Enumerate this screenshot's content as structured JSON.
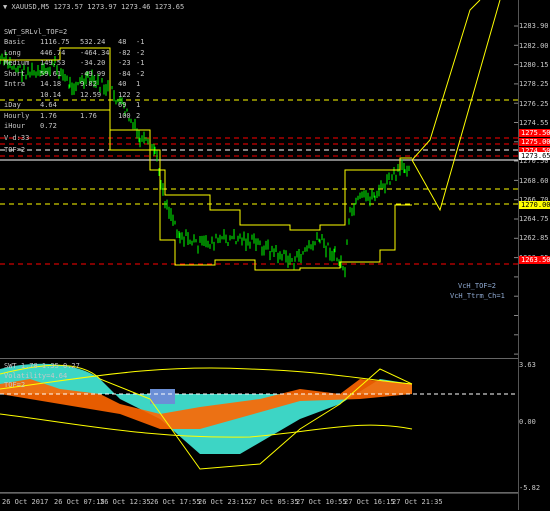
{
  "header": {
    "symbol_line": "XAUUSD,M5  1273.57 1273.97 1273.46 1273.65"
  },
  "info_block": {
    "title": "SWT_SRLvl_TOF=2",
    "rows": [
      {
        "label": "Basic",
        "c1": "1116.75",
        "c2": "532.24",
        "c3": "48",
        "c4": "-1"
      },
      {
        "label": "Long",
        "c1": "446.74",
        "c2": "-464.34",
        "c3": "-82",
        "c4": "-2"
      },
      {
        "label": "Medium",
        "c1": "149.53",
        "c2": "-34.20",
        "c3": "-23",
        "c4": "-1"
      },
      {
        "label": "Short",
        "c1": "59.61",
        "c2": "-49.99",
        "c3": "-84",
        "c4": "-2"
      },
      {
        "label": "Intra",
        "c1": "14.18",
        "c2": "9.82",
        "c3": "40",
        "c4": "1"
      },
      {
        "label": "",
        "c1": "10.14",
        "c2": "12.59",
        "c3": "122",
        "c4": "2"
      },
      {
        "label": "iDay",
        "c1": "4.64",
        "c2": "",
        "c3": "69",
        "c4": "1"
      },
      {
        "label": "Hourly",
        "c1": "1.76",
        "c2": "1.76",
        "c3": "100",
        "c4": "2"
      },
      {
        "label": "iHour",
        "c1": "0.72",
        "c2": "",
        "c3": "",
        "c4": ""
      }
    ],
    "vd_label": "V d:33",
    "tof_label": "TOF=2"
  },
  "price_axis": {
    "labels": [
      "1283.90",
      "1282.00",
      "1280.15",
      "1278.25",
      "1276.25",
      "1274.55",
      "1272.65",
      "1270.50",
      "1268.60",
      "1266.70",
      "1264.75",
      "1262.85",
      "1260.95"
    ],
    "tags": [
      {
        "text": "1275.50",
        "bg": "#ff0000",
        "fg": "#ffffff"
      },
      {
        "text": "1275.00",
        "bg": "#ff0000",
        "fg": "#ffffff"
      },
      {
        "text": "1274.50",
        "bg": "#ff0000",
        "fg": "#ffffff"
      },
      {
        "text": "1273.65",
        "bg": "#ffffff",
        "fg": "#000000"
      },
      {
        "text": "1270.00",
        "bg": "#ffff00",
        "fg": "#000000"
      },
      {
        "text": "1263.50",
        "bg": "#ff0000",
        "fg": "#ffffff"
      }
    ]
  },
  "main_labels": {
    "vch_tof": "VcH_TOF=2",
    "vch_ttrm": "VcH_Ttrm_Ch=1"
  },
  "sub_header": {
    "title": "SWT  1.78  1.35  0.27",
    "volatility": "Volatility=4.64",
    "tof": "TOF=2"
  },
  "sub_axis": {
    "top": "3.63",
    "mid": "0.00",
    "bottom": "-5.82"
  },
  "time_axis": {
    "labels": [
      "26 Oct 2017",
      "26 Oct 07:15",
      "26 Oct 12:35",
      "26 Oct 17:55",
      "26 Oct 23:15",
      "27 Oct 05:35",
      "27 Oct 10:55",
      "27 Oct 16:15",
      "27 Oct 21:35"
    ]
  },
  "colors": {
    "candles": "#00ff00",
    "channel": "#ffff00",
    "resistance": "#ff0000",
    "fill_cyan": "#40e0d0",
    "fill_orange": "#ff6600",
    "fill_blue": "#6b8fd6"
  },
  "icons": {
    "dropdown": "triangle-down-icon"
  }
}
